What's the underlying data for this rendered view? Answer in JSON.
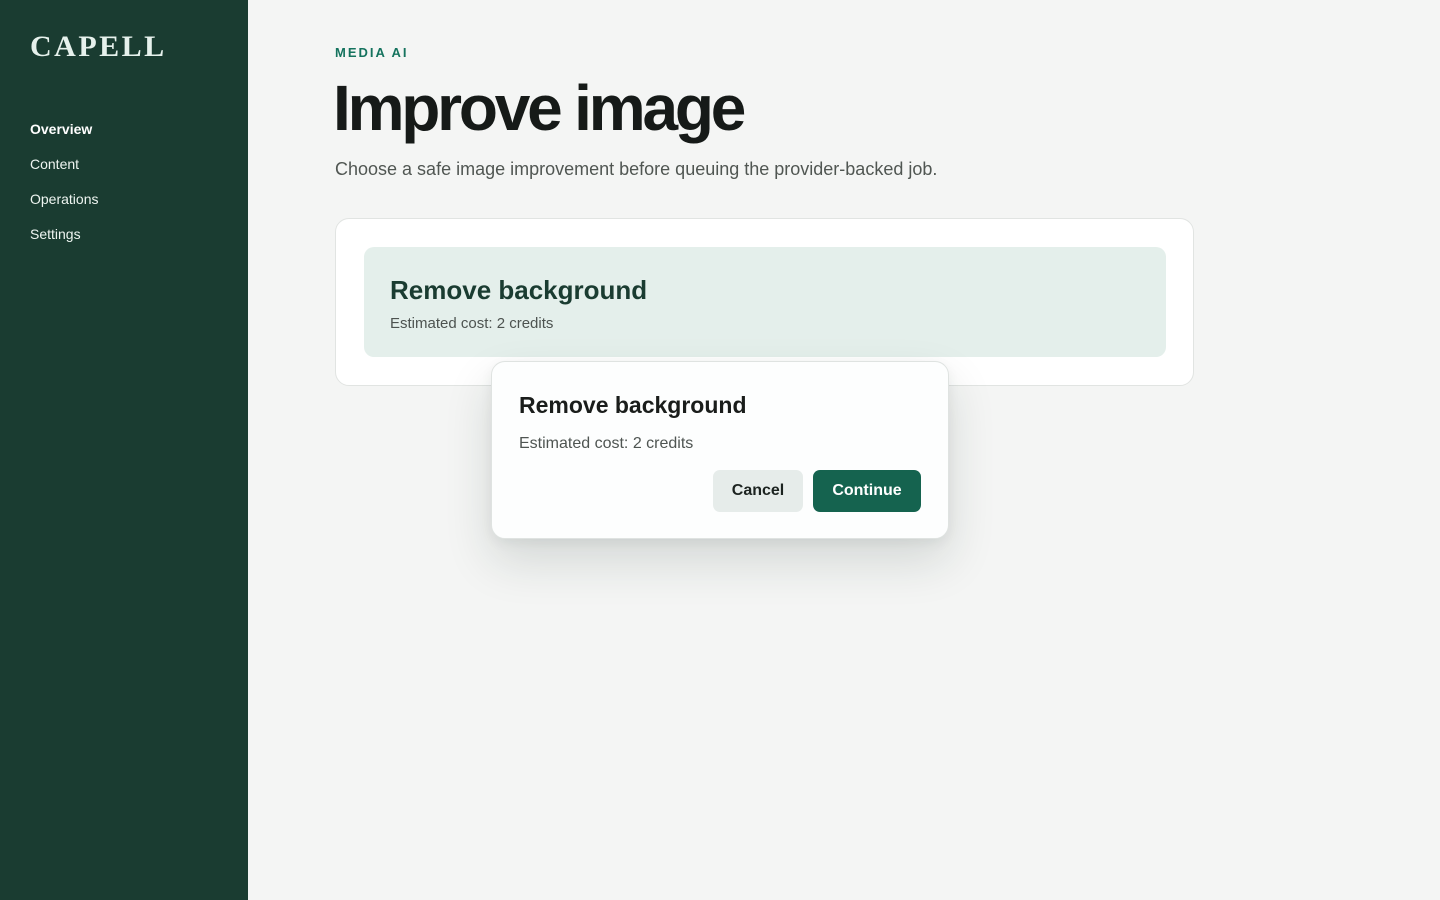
{
  "sidebar": {
    "logo": "CAPELL",
    "items": [
      {
        "label": "Overview",
        "active": true
      },
      {
        "label": "Content",
        "active": false
      },
      {
        "label": "Operations",
        "active": false
      },
      {
        "label": "Settings",
        "active": false
      }
    ]
  },
  "main": {
    "eyebrow": "MEDIA AI",
    "title": "Improve image",
    "subtitle": "Choose a safe image improvement before queuing the provider-backed job.",
    "option": {
      "title": "Remove background",
      "cost": "Estimated cost: 2 credits"
    }
  },
  "dialog": {
    "title": "Remove background",
    "cost": "Estimated cost: 2 credits",
    "cancel_label": "Cancel",
    "continue_label": "Continue"
  },
  "colors": {
    "sidebar_bg": "#1a3c31",
    "accent": "#15735e",
    "primary_button": "#15634f",
    "option_card_bg": "#e4efeb",
    "page_bg": "#f4f5f4"
  }
}
